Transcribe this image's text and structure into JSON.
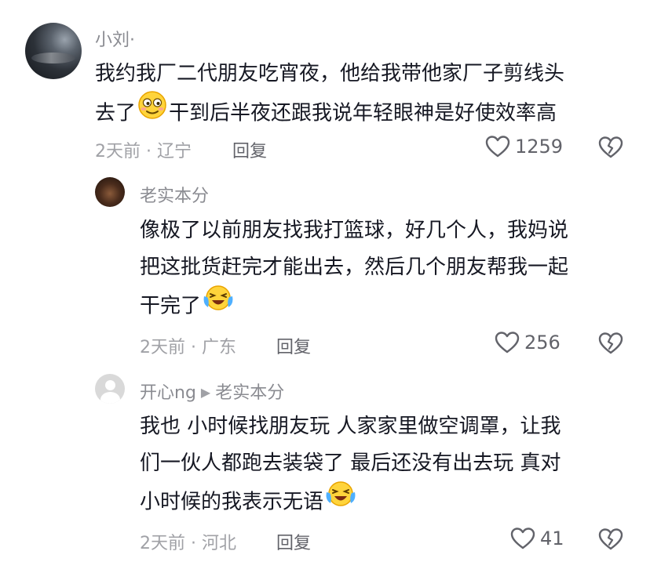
{
  "comments": [
    {
      "user": "小刘·",
      "lines": [
        "我约我厂二代朋友吃宵夜，他给我带他家厂子剪线头",
        "去了",
        "干到后半夜还跟我说年轻眼神是好使效率高"
      ],
      "time_location": "2天前 · 辽宁",
      "reply_label": "回复",
      "likes": "1259"
    },
    {
      "user": "老实本分",
      "lines": [
        "像极了以前朋友找我打篮球，好几个人，我妈说",
        "把这批货赶完才能出去，然后几个朋友帮我一起",
        "干完了"
      ],
      "time_location": "2天前 · 广东",
      "reply_label": "回复",
      "likes": "256"
    },
    {
      "user": "开心ng",
      "reply_to": "老实本分",
      "lines": [
        "我也 小时候找朋友玩 人家家里做空调罩，让我",
        "们一伙人都跑去装袋了 最后还没有出去玩 真对",
        "小时候的我表示无语"
      ],
      "time_location": "2天前 · 河北",
      "reply_label": "回复",
      "likes": "41"
    }
  ],
  "icons": {
    "like": "heart-outline-icon",
    "dislike": "broken-heart-icon",
    "emoji1": "awkward-smile-emoji",
    "emoji2": "laugh-cry-emoji"
  }
}
